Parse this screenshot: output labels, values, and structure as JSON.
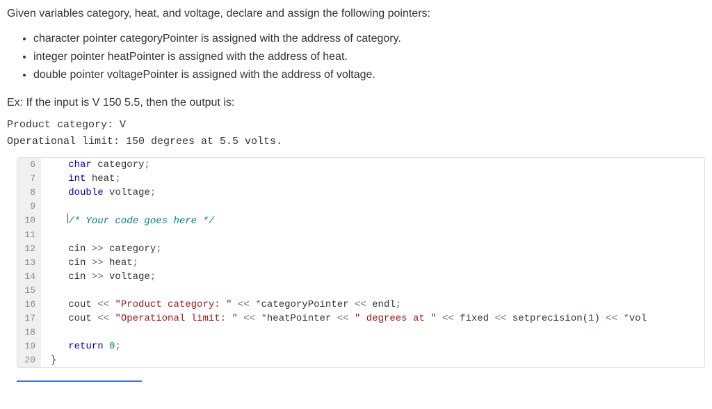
{
  "intro": "Given variables category, heat, and voltage, declare and assign the following pointers:",
  "requirements": [
    "character pointer categoryPointer is assigned with the address of category.",
    "integer pointer heatPointer is assigned with the address of heat.",
    "double pointer voltagePointer is assigned with the address of voltage."
  ],
  "example_label": "Ex: If the input is V 150 5.5, then the output is:",
  "output_line1": "Product category: V",
  "output_line2": "Operational limit: 150 degrees at 5.5 volts.",
  "code": {
    "lines": [
      {
        "n": "6",
        "segs": [
          [
            "   ",
            ""
          ],
          [
            "char",
            "kw"
          ],
          [
            " category",
            ""
          ],
          [
            ";",
            "op"
          ]
        ]
      },
      {
        "n": "7",
        "segs": [
          [
            "   ",
            ""
          ],
          [
            "int",
            "kw"
          ],
          [
            " heat",
            ""
          ],
          [
            ";",
            "op"
          ]
        ]
      },
      {
        "n": "8",
        "segs": [
          [
            "   ",
            ""
          ],
          [
            "double",
            "kw"
          ],
          [
            " voltage",
            ""
          ],
          [
            ";",
            "op"
          ]
        ]
      },
      {
        "n": "9",
        "segs": [
          [
            "",
            ""
          ]
        ]
      },
      {
        "n": "10",
        "segs": [
          [
            "   ",
            ""
          ],
          [
            "/* Your code goes here */",
            "cmt"
          ]
        ],
        "cursor": true
      },
      {
        "n": "11",
        "segs": [
          [
            "",
            ""
          ]
        ]
      },
      {
        "n": "12",
        "segs": [
          [
            "   cin ",
            ""
          ],
          [
            ">>",
            "op"
          ],
          [
            " category",
            ""
          ],
          [
            ";",
            "op"
          ]
        ]
      },
      {
        "n": "13",
        "segs": [
          [
            "   cin ",
            ""
          ],
          [
            ">>",
            "op"
          ],
          [
            " heat",
            ""
          ],
          [
            ";",
            "op"
          ]
        ]
      },
      {
        "n": "14",
        "segs": [
          [
            "   cin ",
            ""
          ],
          [
            ">>",
            "op"
          ],
          [
            " voltage",
            ""
          ],
          [
            ";",
            "op"
          ]
        ]
      },
      {
        "n": "15",
        "segs": [
          [
            "",
            ""
          ]
        ]
      },
      {
        "n": "16",
        "segs": [
          [
            "   cout ",
            ""
          ],
          [
            "<<",
            "op"
          ],
          [
            " ",
            ""
          ],
          [
            "\"Product category: \"",
            "str"
          ],
          [
            " ",
            ""
          ],
          [
            "<<",
            "op"
          ],
          [
            " ",
            ""
          ],
          [
            "*",
            "op"
          ],
          [
            "categoryPointer ",
            ""
          ],
          [
            "<<",
            "op"
          ],
          [
            " endl",
            ""
          ],
          [
            ";",
            "op"
          ]
        ]
      },
      {
        "n": "17",
        "segs": [
          [
            "   cout ",
            ""
          ],
          [
            "<<",
            "op"
          ],
          [
            " ",
            ""
          ],
          [
            "\"Operational limit: \"",
            "str"
          ],
          [
            " ",
            ""
          ],
          [
            "<<",
            "op"
          ],
          [
            " ",
            ""
          ],
          [
            "*",
            "op"
          ],
          [
            "heatPointer ",
            ""
          ],
          [
            "<<",
            "op"
          ],
          [
            " ",
            ""
          ],
          [
            "\" degrees at \"",
            "str"
          ],
          [
            " ",
            ""
          ],
          [
            "<<",
            "op"
          ],
          [
            " fixed ",
            ""
          ],
          [
            "<<",
            "op"
          ],
          [
            " setprecision(",
            ""
          ],
          [
            "1",
            "num"
          ],
          [
            ") ",
            ""
          ],
          [
            "<<",
            "op"
          ],
          [
            " ",
            ""
          ],
          [
            "*",
            "op"
          ],
          [
            "vol",
            ""
          ]
        ]
      },
      {
        "n": "18",
        "segs": [
          [
            "",
            ""
          ]
        ]
      },
      {
        "n": "19",
        "segs": [
          [
            "   ",
            ""
          ],
          [
            "return",
            "kw"
          ],
          [
            " ",
            ""
          ],
          [
            "0",
            "num"
          ],
          [
            ";",
            "op"
          ]
        ]
      },
      {
        "n": "20",
        "segs": [
          [
            "}",
            ""
          ]
        ]
      }
    ]
  }
}
